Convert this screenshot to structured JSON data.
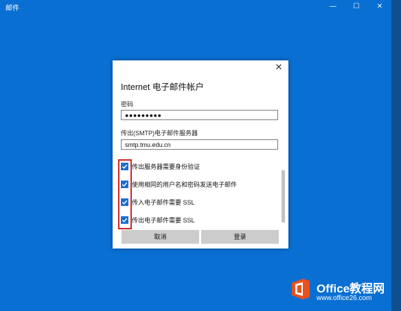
{
  "app": {
    "title": "邮件"
  },
  "window_controls": {
    "minimize": "—",
    "maximize": "☐",
    "close": "✕"
  },
  "dialog": {
    "title": "Internet 电子邮件帐户",
    "close_glyph": "✕",
    "password": {
      "label": "密码",
      "value": "●●●●●●●●●"
    },
    "smtp": {
      "label": "传出(SMTP)电子邮件服务器",
      "value": "smtp.tmu.edu.cn"
    },
    "options": [
      {
        "label": "传出服务器需要身份验证",
        "checked": true
      },
      {
        "label": "使用相同的用户名和密码发送电子邮件",
        "checked": true
      },
      {
        "label": "传入电子邮件需要 SSL",
        "checked": true
      },
      {
        "label": "传出电子邮件需要 SSL",
        "checked": true
      }
    ],
    "buttons": {
      "cancel": "取消",
      "login": "登录"
    }
  },
  "watermark": {
    "name": "Office教程网",
    "url": "www.office26.com"
  },
  "colors": {
    "background": "#0a6fd2",
    "accent": "#1b6ed1",
    "highlight": "#d42020",
    "brand_orange": "#e8501d"
  }
}
